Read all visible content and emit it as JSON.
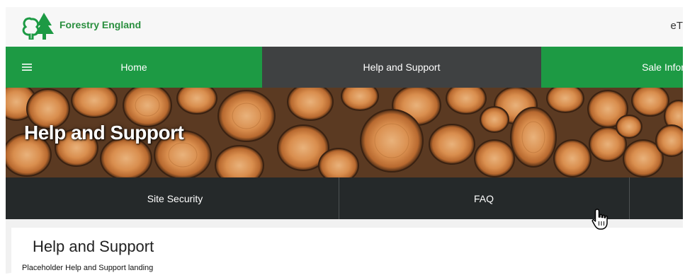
{
  "header": {
    "brand": "Forestry England",
    "user_text": "eT"
  },
  "nav": {
    "items": [
      {
        "label": "Home",
        "active": false
      },
      {
        "label": "Help and Support",
        "active": true
      },
      {
        "label": "Sale Infor",
        "active": false
      }
    ]
  },
  "hero": {
    "title": "Help and Support"
  },
  "subnav": {
    "items": [
      {
        "label": "Site Security"
      },
      {
        "label": "FAQ"
      }
    ]
  },
  "content": {
    "title": "Help and Support",
    "text": "Placeholder Help and Support landing"
  },
  "colors": {
    "brand_green": "#1d9a44",
    "nav_active": "#3f4142",
    "subnav_bg": "#25292a",
    "brand_text": "#2a8f3f"
  },
  "icons": {
    "logo": "tree-logo-icon",
    "menu": "hamburger-menu-icon",
    "cursor": "hand-pointer-icon"
  }
}
